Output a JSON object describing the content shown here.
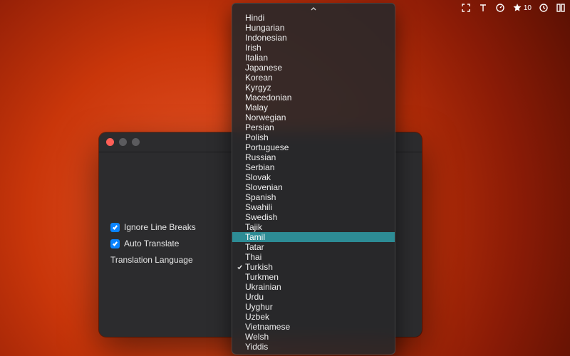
{
  "menubar": {
    "star_count": "10"
  },
  "settings": {
    "ignore_line_breaks_label": "Ignore Line Breaks",
    "auto_translate_label": "Auto Translate",
    "translation_language_label": "Translation Language"
  },
  "dropdown": {
    "selected": "Turkish",
    "highlighted": "Tamil",
    "items": [
      "Hindi",
      "Hungarian",
      "Indonesian",
      "Irish",
      "Italian",
      "Japanese",
      "Korean",
      "Kyrgyz",
      "Macedonian",
      "Malay",
      "Norwegian",
      "Persian",
      "Polish",
      "Portuguese",
      "Russian",
      "Serbian",
      "Slovak",
      "Slovenian",
      "Spanish",
      "Swahili",
      "Swedish",
      "Tajik",
      "Tamil",
      "Tatar",
      "Thai",
      "Turkish",
      "Turkmen",
      "Ukrainian",
      "Urdu",
      "Uyghur",
      "Uzbek",
      "Vietnamese",
      "Welsh",
      "Yiddis"
    ]
  }
}
